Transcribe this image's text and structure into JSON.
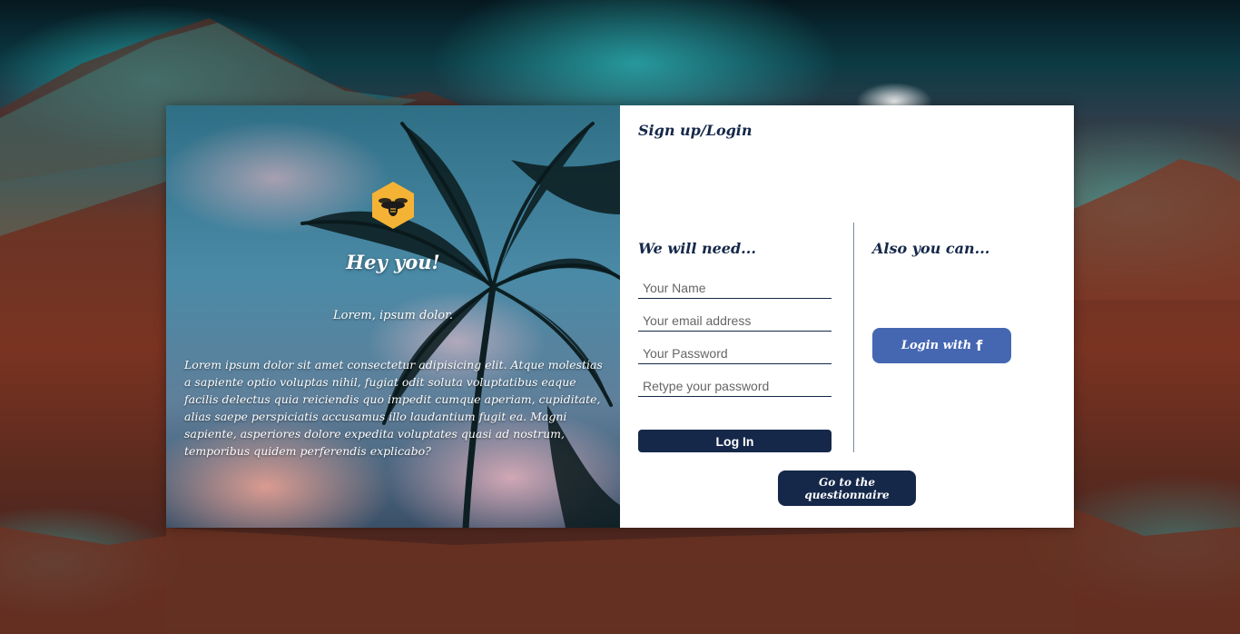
{
  "left_panel": {
    "heading": "Hey you!",
    "subheading": "Lorem, ipsum dolor.",
    "paragraph": "Lorem ipsum dolor sit amet consectetur adipisicing elit. Atque molestias a sapiente optio voluptas nihil, fugiat odit soluta voluptatibus eaque facilis delectus quia reiciendis quo impedit cumque aperiam, cupiditate, alias saepe perspiciatis accusamus illo laudantium fugit ea. Magni sapiente, asperiores dolore expedita voluptates quasi ad nostrum, temporibus quidem perferendis explicabo?",
    "logo_icon": "bee-hexagon-icon"
  },
  "right_panel": {
    "title": "Sign up/Login",
    "need_heading": "We will need...",
    "also_heading": "Also you can...",
    "fields": {
      "name_placeholder": "Your Name",
      "email_placeholder": "Your email address",
      "password_placeholder": "Your Password",
      "retype_placeholder": "Retype your password"
    },
    "login_button": "Log In",
    "facebook_button": "Login with",
    "facebook_icon": "f",
    "questionnaire_button": "Go to the questionnaire"
  },
  "colors": {
    "navy": "#15284a",
    "facebook_blue": "#4567b2",
    "logo_amber": "#f5b335"
  }
}
